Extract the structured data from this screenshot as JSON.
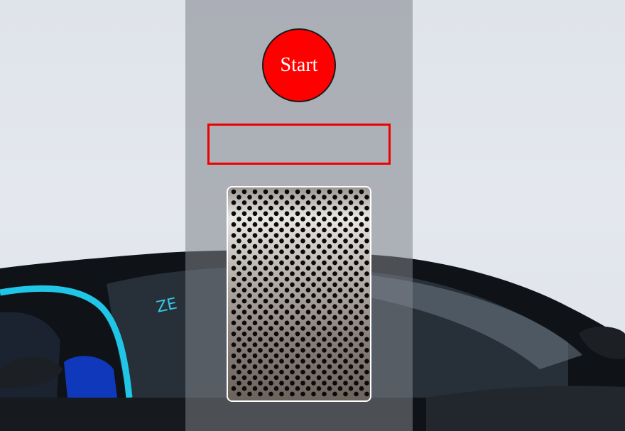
{
  "start_button": {
    "label": "Start"
  },
  "result_display": {
    "value": ""
  },
  "icons": {
    "background": "supercar-photo",
    "grille": "speaker-grille-icon"
  },
  "colors": {
    "start_button_fill": "#ff0000",
    "result_border": "#ee0000",
    "panel_overlay": "#80838a"
  }
}
